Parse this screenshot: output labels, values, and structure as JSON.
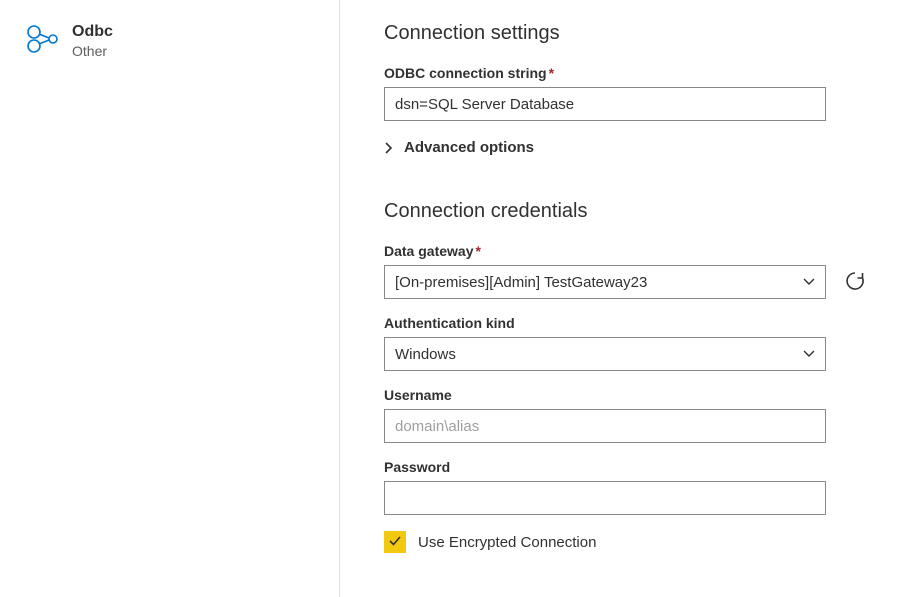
{
  "sidebar": {
    "connector_name": "Odbc",
    "connector_category": "Other"
  },
  "settings": {
    "heading": "Connection settings",
    "conn_string_label": "ODBC connection string",
    "conn_string_value": "dsn=SQL Server Database",
    "advanced_label": "Advanced options"
  },
  "credentials": {
    "heading": "Connection credentials",
    "gateway_label": "Data gateway",
    "gateway_value": "[On-premises][Admin] TestGateway23",
    "auth_kind_label": "Authentication kind",
    "auth_kind_value": "Windows",
    "username_label": "Username",
    "username_placeholder": "domain\\alias",
    "username_value": "",
    "password_label": "Password",
    "password_value": "",
    "encrypted_checked": true,
    "encrypted_label": "Use Encrypted Connection"
  }
}
